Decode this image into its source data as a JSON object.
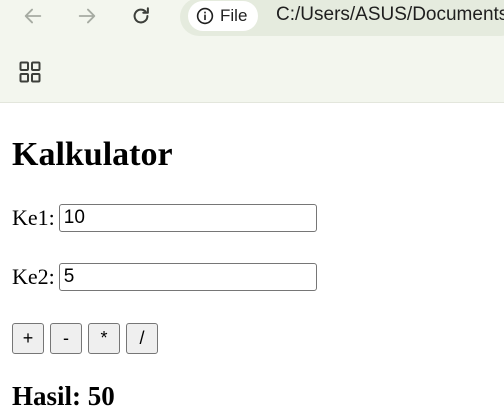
{
  "browser": {
    "file_chip_label": "File",
    "url": "C:/Users/ASUS/Documents",
    "icons": {
      "back": "arrow-left-icon",
      "forward": "arrow-right-icon",
      "reload": "reload-icon",
      "info": "info-icon",
      "apps": "apps-grid-icon"
    }
  },
  "page": {
    "title": "Kalkulator",
    "field1": {
      "label": "Ke1:",
      "value": "10"
    },
    "field2": {
      "label": "Ke2:",
      "value": "5"
    },
    "operators": [
      {
        "label": "+"
      },
      {
        "label": "-"
      },
      {
        "label": "*"
      },
      {
        "label": "/"
      }
    ],
    "result_text": "Hasil: 50"
  },
  "colors": {
    "toolbar_bg": "#f3f6ee",
    "omnibox_bg": "#e5ebde",
    "icon_muted": "#a6aba2",
    "icon_active": "#3c3f3a"
  }
}
